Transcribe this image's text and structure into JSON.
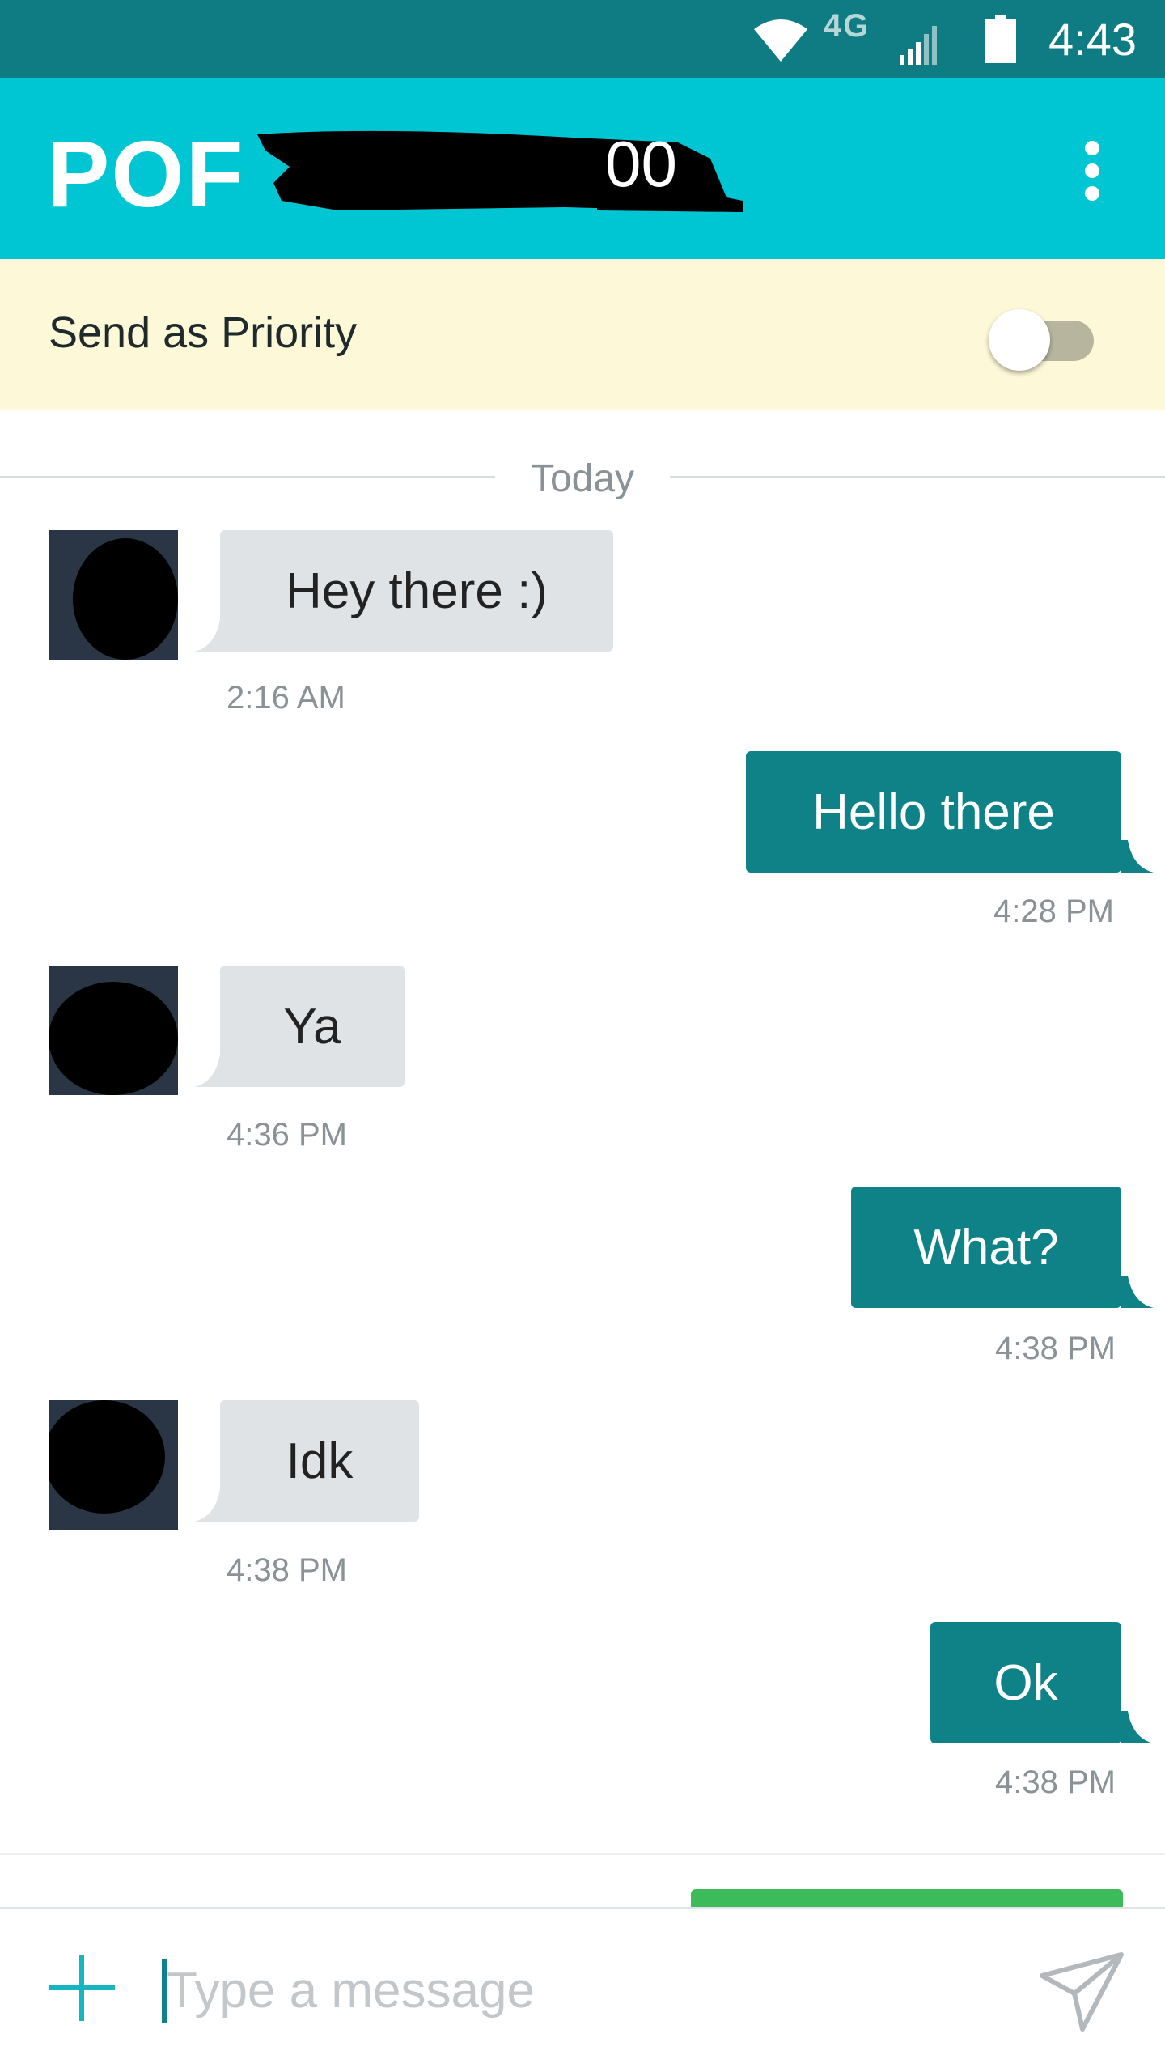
{
  "status_bar": {
    "network": "4G",
    "time": "4:43"
  },
  "app_bar": {
    "brand": "POF",
    "menu_icon": "more-vert-icon"
  },
  "priority": {
    "label": "Send as Priority",
    "enabled": false
  },
  "divider": {
    "label": "Today"
  },
  "messages": [
    {
      "direction": "in",
      "text": "Hey there :)",
      "time": "2:16 AM"
    },
    {
      "direction": "out",
      "text": "Hello there",
      "time": "4:28 PM"
    },
    {
      "direction": "in",
      "text": "Ya",
      "time": "4:36 PM"
    },
    {
      "direction": "out",
      "text": "What?",
      "time": "4:38 PM"
    },
    {
      "direction": "in",
      "text": "Idk",
      "time": "4:38 PM"
    },
    {
      "direction": "out",
      "text": "Ok",
      "time": "4:38 PM"
    }
  ],
  "composer": {
    "placeholder": "Type a message",
    "add_icon": "plus-icon",
    "send_icon": "send-icon"
  },
  "colors": {
    "status_bar": "#0e7c82",
    "app_bar": "#00c6d3",
    "priority_bg": "#fdf8d8",
    "outgoing_bubble": "#0e8287",
    "incoming_bubble": "#dfe3e6",
    "accent_green": "#3dba5a"
  }
}
